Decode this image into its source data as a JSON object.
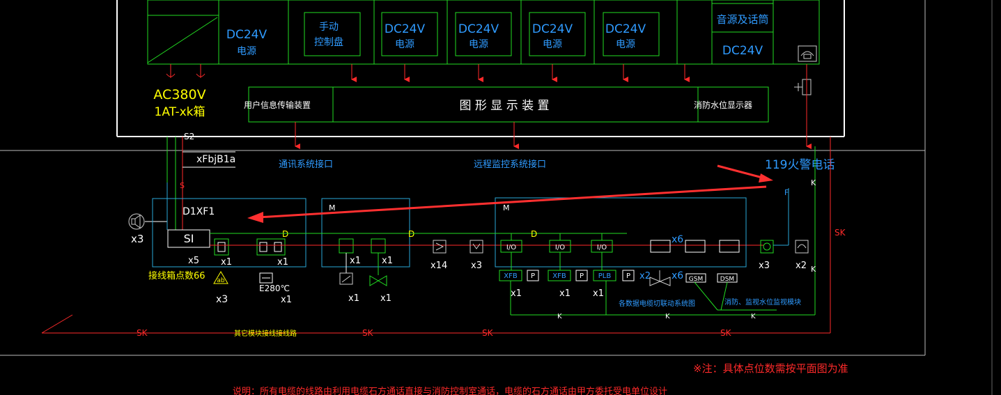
{
  "top_panel": {
    "modules": [
      {
        "line1": "DC24V",
        "line2": "电源"
      },
      {
        "line1": "手动",
        "line2": "控制盘"
      },
      {
        "line1": "DC24V",
        "line2": "电源"
      },
      {
        "line1": "DC24V",
        "line2": "电源"
      },
      {
        "line1": "DC24V",
        "line2": "电源"
      },
      {
        "line1": "DC24V",
        "line2": "电源"
      }
    ],
    "right_col_1": "音源及话筒",
    "right_col_2": "DC24V",
    "ac_label_1": "AC380V",
    "ac_label_2": "1AT-xk箱",
    "display_bar": {
      "left": "用户信息传输装置",
      "center": "图 形 显 示 装 置",
      "right": "消防水位显示器"
    }
  },
  "interfaces": {
    "comm": "通讯系统接口",
    "remote": "远程监控系统接口",
    "fire119": "119火警电话"
  },
  "wire_labels": {
    "cable_tag": "xFbjB1a",
    "s2": "S2",
    "s": "S",
    "d": "D",
    "f": "F",
    "k": "K",
    "sk": "SK"
  },
  "boxes": {
    "box1": {
      "title": "D1XF1",
      "device": "SI",
      "x5": "x5",
      "x1a": "x1",
      "x1b": "x1",
      "x3": "x3",
      "x1c": "x1",
      "temp": "E280℃",
      "note": "接线箱点数66"
    },
    "box2": {
      "title": "M",
      "x1a": "x1",
      "x1b": "x1",
      "x1c": "x1",
      "x1d": "x1"
    },
    "mid": {
      "x14": "x14",
      "x3": "x3"
    },
    "box3": {
      "title": "M",
      "io": [
        "I/O",
        "I/O",
        "I/O"
      ],
      "x6a": "x6",
      "x6b": "x6",
      "x2a": "x2",
      "x3": "x3",
      "x2b": "x2",
      "units": [
        "XFB",
        "XFB",
        "PLB"
      ],
      "p": "P",
      "x1a": "x1",
      "x1b": "x1",
      "x1c": "x1",
      "gsm": "GSM",
      "dsm": "DSM",
      "note1": "各数据电缆切联动系统图",
      "note2": "消防、监视水位监视模块"
    }
  },
  "bottom": {
    "sk_note": "其它模块接线接线路",
    "footnote": "※注：具体点位数需按平面图为准",
    "bottom_text": "说明：所有电缆的线路由利用电缆石方通话直接与消防控制室通话，电缆的石方通话由甲方委托受电单位设计"
  },
  "colors": {
    "green": "#22dd22",
    "red": "#ff2a2a",
    "cyan": "#2aa8d8",
    "blue": "#2f9bff",
    "yellow": "#ffff00",
    "white": "#ffffff"
  }
}
